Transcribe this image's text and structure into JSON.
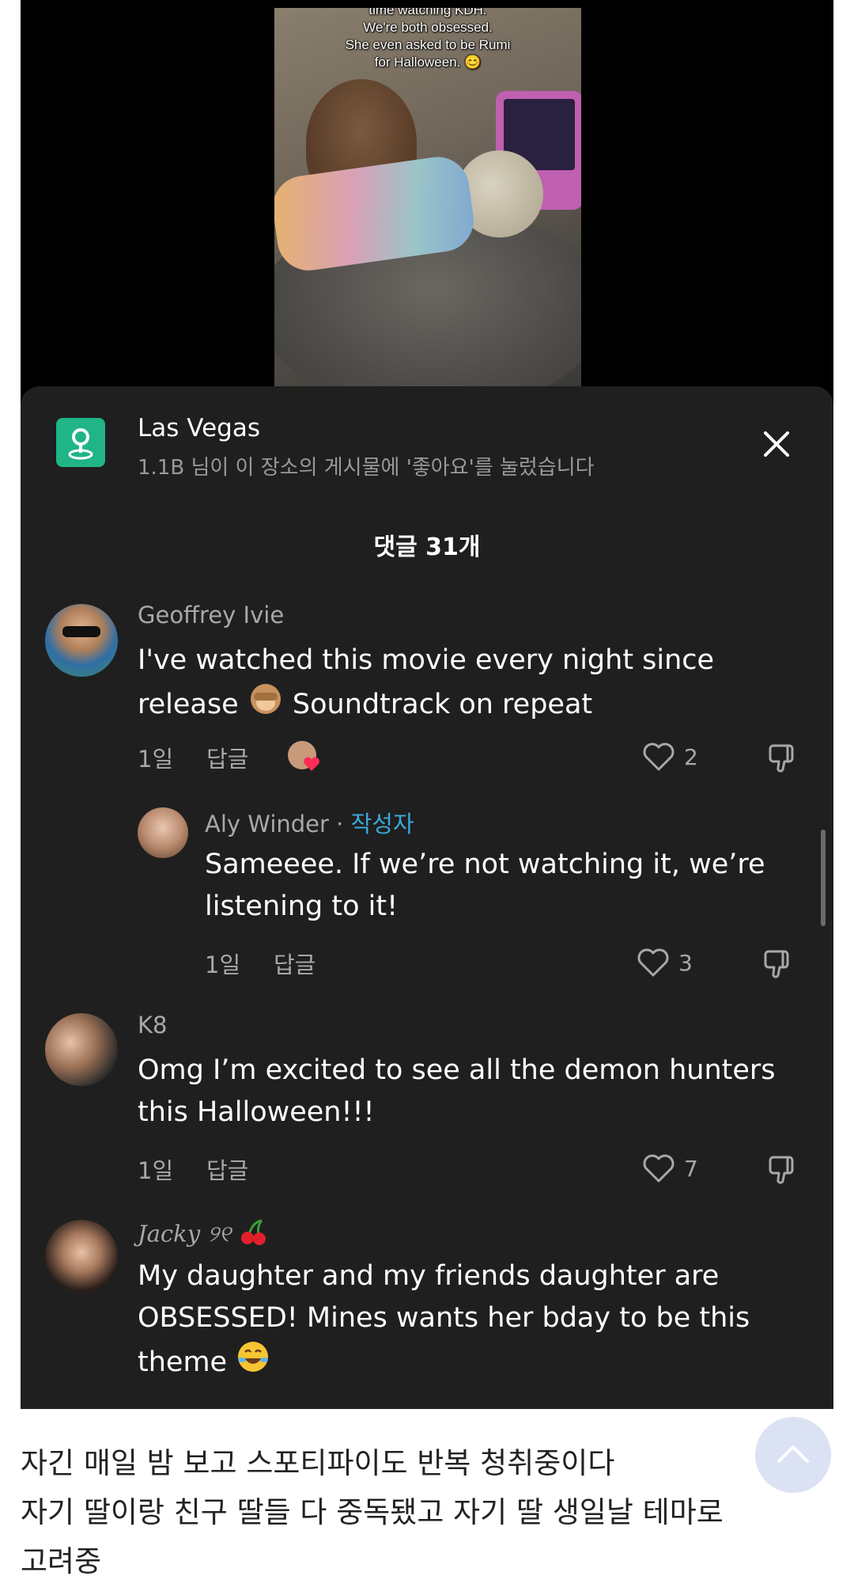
{
  "video": {
    "caption_lines": [
      "time watching KDH.",
      "We're both obsessed.",
      "She even asked to be Rumi",
      "for Halloween. 😊"
    ]
  },
  "location": {
    "title": "Las Vegas",
    "subtitle": "1.1B 님이 이 장소의 게시물에 '좋아요'를 눌렀습니다",
    "icon": "map-pin-icon",
    "accent": "#1fb587"
  },
  "comments_header": "댓글 31개",
  "comments": [
    {
      "user": "Geoffrey Ivie",
      "text_line1": "I've watched this movie every night since",
      "text_line2a": "release",
      "text_line2b": "Soundtrack on repeat",
      "age": "1일",
      "reply": "답글",
      "likes": "2"
    },
    {
      "user": "Aly Winder",
      "badge": "작성자",
      "text_line1": "Sameeee. If we’re not watching it, we’re",
      "text_line2": "listening to it!",
      "age": "1일",
      "reply": "답글",
      "likes": "3"
    },
    {
      "user": "K8",
      "text_line1": "Omg I’m excited to see all the demon hunters",
      "text_line2": "this Halloween!!!",
      "age": "1일",
      "reply": "답글",
      "likes": "7"
    },
    {
      "user": "Jacky ୨୧",
      "text_line1": "My daughter and my friends daughter are",
      "text_line2": "OBSESSED! Mines wants her bday to be this",
      "text_line3": "theme"
    }
  ],
  "post_text": {
    "line1": "자긴 매일 밤 보고 스포티파이도 반복 청취중이다",
    "line2": "자기 딸이랑 친구 딸들 다 중독됐고 자기 딸 생일날 테마로",
    "line3": "고려중"
  },
  "colors": {
    "author_badge": "#3aa9d9",
    "sheet_bg": "#1f1f1f",
    "scroll_top_bg": "#dbe2f3"
  }
}
